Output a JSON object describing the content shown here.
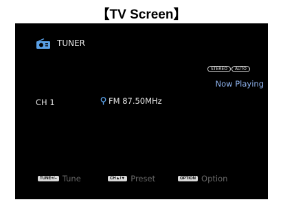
{
  "caption": "【TV Screen】",
  "source": {
    "icon": "radio-icon",
    "label": "TUNER"
  },
  "badges": [
    "STEREO",
    "AUTO"
  ],
  "status": "Now Playing",
  "channel": "CH 1",
  "station": {
    "icon": "preset-pin-icon",
    "frequency": "FM 87.50MHz"
  },
  "footer": [
    {
      "key": "TUNE+/–",
      "label": "Tune"
    },
    {
      "key": "CH▲/▼",
      "label": "Preset"
    },
    {
      "key": "OPTION",
      "label": "Option"
    }
  ],
  "colors": {
    "screen": "#000000",
    "text": "#e8e8e8",
    "accent": "#8fb4f0",
    "dim_text": "#6a6a6a",
    "icon_blue": "#5aa0e6"
  }
}
